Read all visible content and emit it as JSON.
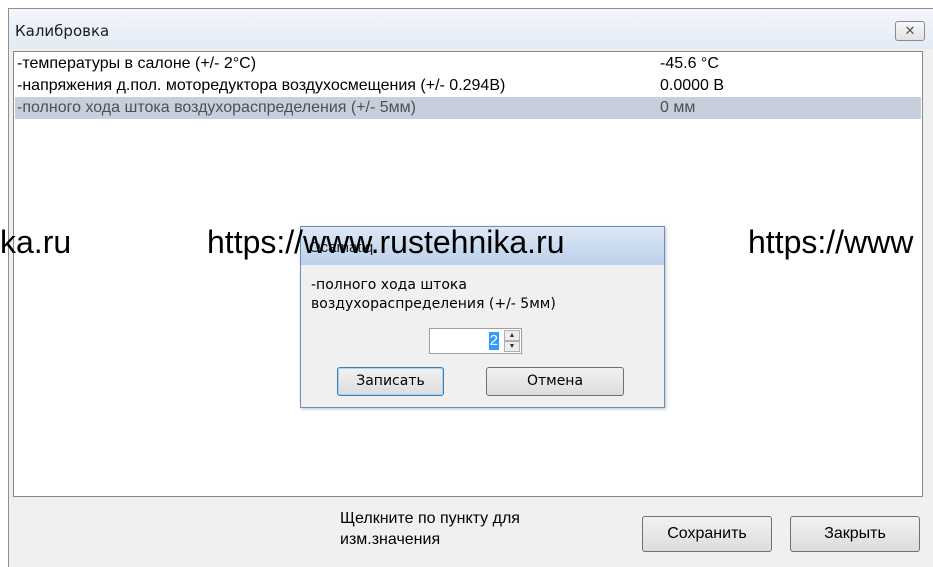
{
  "window": {
    "title": "Калибровка",
    "close_glyph": "✕"
  },
  "list": {
    "rows": [
      {
        "name": "-температуры в салоне (+/- 2°C)",
        "value": "-45.6 °C"
      },
      {
        "name": "-напряжения д.пол. моторедуктора воздухосмещения (+/- 0.294В)",
        "value": "0.0000 В"
      },
      {
        "name": "-полного хода штока воздухораспределения (+/- 5мм)",
        "value": "0 мм"
      }
    ]
  },
  "footer": {
    "hint_line1": "Щелкните по пункту для",
    "hint_line2": "изм.значения",
    "save_label": "Сохранить",
    "close_label": "Закрыть"
  },
  "dialog": {
    "title": "Ocamatiq",
    "label_line1": "-полного хода штока",
    "label_line2": "воздухораспределения (+/- 5мм)",
    "value": "2",
    "write_label": "Записать",
    "cancel_label": "Отмена",
    "spin_up_glyph": "▲",
    "spin_down_glyph": "▼"
  },
  "watermark": {
    "left": "ka.ru",
    "center": "https://www.rustehnika.ru",
    "right": "https://www"
  }
}
